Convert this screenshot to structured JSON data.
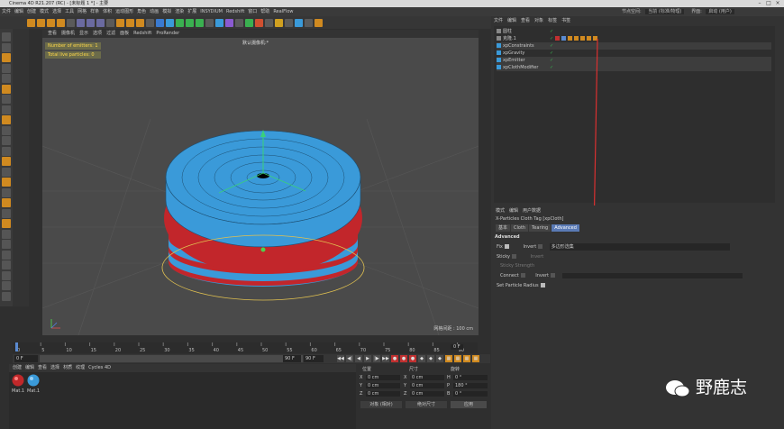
{
  "window": {
    "title": "Cinema 4D R21.207 (RC) - [未标题 1 *] - 主要"
  },
  "menubar": [
    "文件",
    "编辑",
    "创建",
    "模式",
    "选择",
    "工具",
    "网格",
    "样条",
    "体积",
    "运动图形",
    "角色",
    "动画",
    "模拟",
    "渲染",
    "扩展",
    "INSYDIUM",
    "Redshift",
    "窗口",
    "帮助",
    "RealFlow"
  ],
  "right_header": {
    "label1": "节点空间:",
    "value1": "当前 (标准/物理)",
    "label2": "界面:",
    "value2": "启动 (用户)"
  },
  "viewport": {
    "menu": [
      "查看",
      "摄像机",
      "显示",
      "选项",
      "过滤",
      "面板",
      "Redshift",
      "ProRender"
    ],
    "camera_label": "默认摄像机:*",
    "hud_line1": "Number of emitters: 1",
    "hud_line2": "Total live particles: 0",
    "grid_spacing": "网格间距 : 100 cm"
  },
  "timeline": {
    "ticks": [
      "0",
      "5",
      "10",
      "15",
      "20",
      "25",
      "30",
      "35",
      "40",
      "45",
      "50",
      "55",
      "60",
      "65",
      "70",
      "75",
      "80",
      "85",
      "90"
    ],
    "current_frame": "0 F",
    "start": "0 F",
    "end1": "90 F",
    "end2": "90 F",
    "min": "0 F"
  },
  "materials": {
    "menu": [
      "创建",
      "编辑",
      "查看",
      "选择",
      "材质",
      "纹理",
      "Cycles 4D"
    ],
    "items": [
      "Mat.1",
      "Mat.1"
    ]
  },
  "coordinates": {
    "headers": [
      "位置",
      "尺寸",
      "旋转"
    ],
    "rows": [
      {
        "axis": "X",
        "pos": "0 cm",
        "size_axis": "X",
        "size": "0 cm",
        "rot_axis": "H",
        "rot": "0 °"
      },
      {
        "axis": "Y",
        "pos": "0 cm",
        "size_axis": "Y",
        "size": "0 cm",
        "rot_axis": "P",
        "rot": "180 °"
      },
      {
        "axis": "Z",
        "pos": "0 cm",
        "size_axis": "Z",
        "size": "0 cm",
        "rot_axis": "B",
        "rot": "0 °"
      }
    ],
    "mode1": "对象 (相对)",
    "mode2": "绝对尺寸",
    "apply": "应用"
  },
  "object_manager": {
    "menu": [
      "文件",
      "编辑",
      "查看",
      "对象",
      "标签",
      "书签"
    ],
    "objects": [
      {
        "name": "圆柱",
        "selected": false
      },
      {
        "name": "克隆.1",
        "selected": false
      },
      {
        "name": "xpConstraints",
        "selected": true
      },
      {
        "name": "xpGravity",
        "selected": false
      },
      {
        "name": "xpEmitter",
        "selected": true
      },
      {
        "name": "xpClothModifier",
        "selected": true
      }
    ]
  },
  "attributes": {
    "menu": [
      "模式",
      "编辑",
      "用户数据"
    ],
    "title": "X-Particles Cloth Tag [xpCloth]",
    "tabs": [
      "基本",
      "Cloth",
      "Tearing",
      "Advanced"
    ],
    "active_tab": "Advanced",
    "section": "Advanced",
    "fix_label": "Fix",
    "invert_label": "Invert",
    "fix_value": "多边形选集",
    "sticky_label": "Sticky",
    "sticky_invert": "Invert",
    "sticky_strength": "Sticky Strength",
    "connect_label": "Connect",
    "connect_invert": "Invert",
    "set_radius": "Set Particle Radius"
  },
  "watermark": "野鹿志",
  "colors": {
    "cylinder_blue": "#3a9ad9",
    "cylinder_red": "#c2262b",
    "accent": "#5a7ab5",
    "red_arrow": "#d93030"
  }
}
